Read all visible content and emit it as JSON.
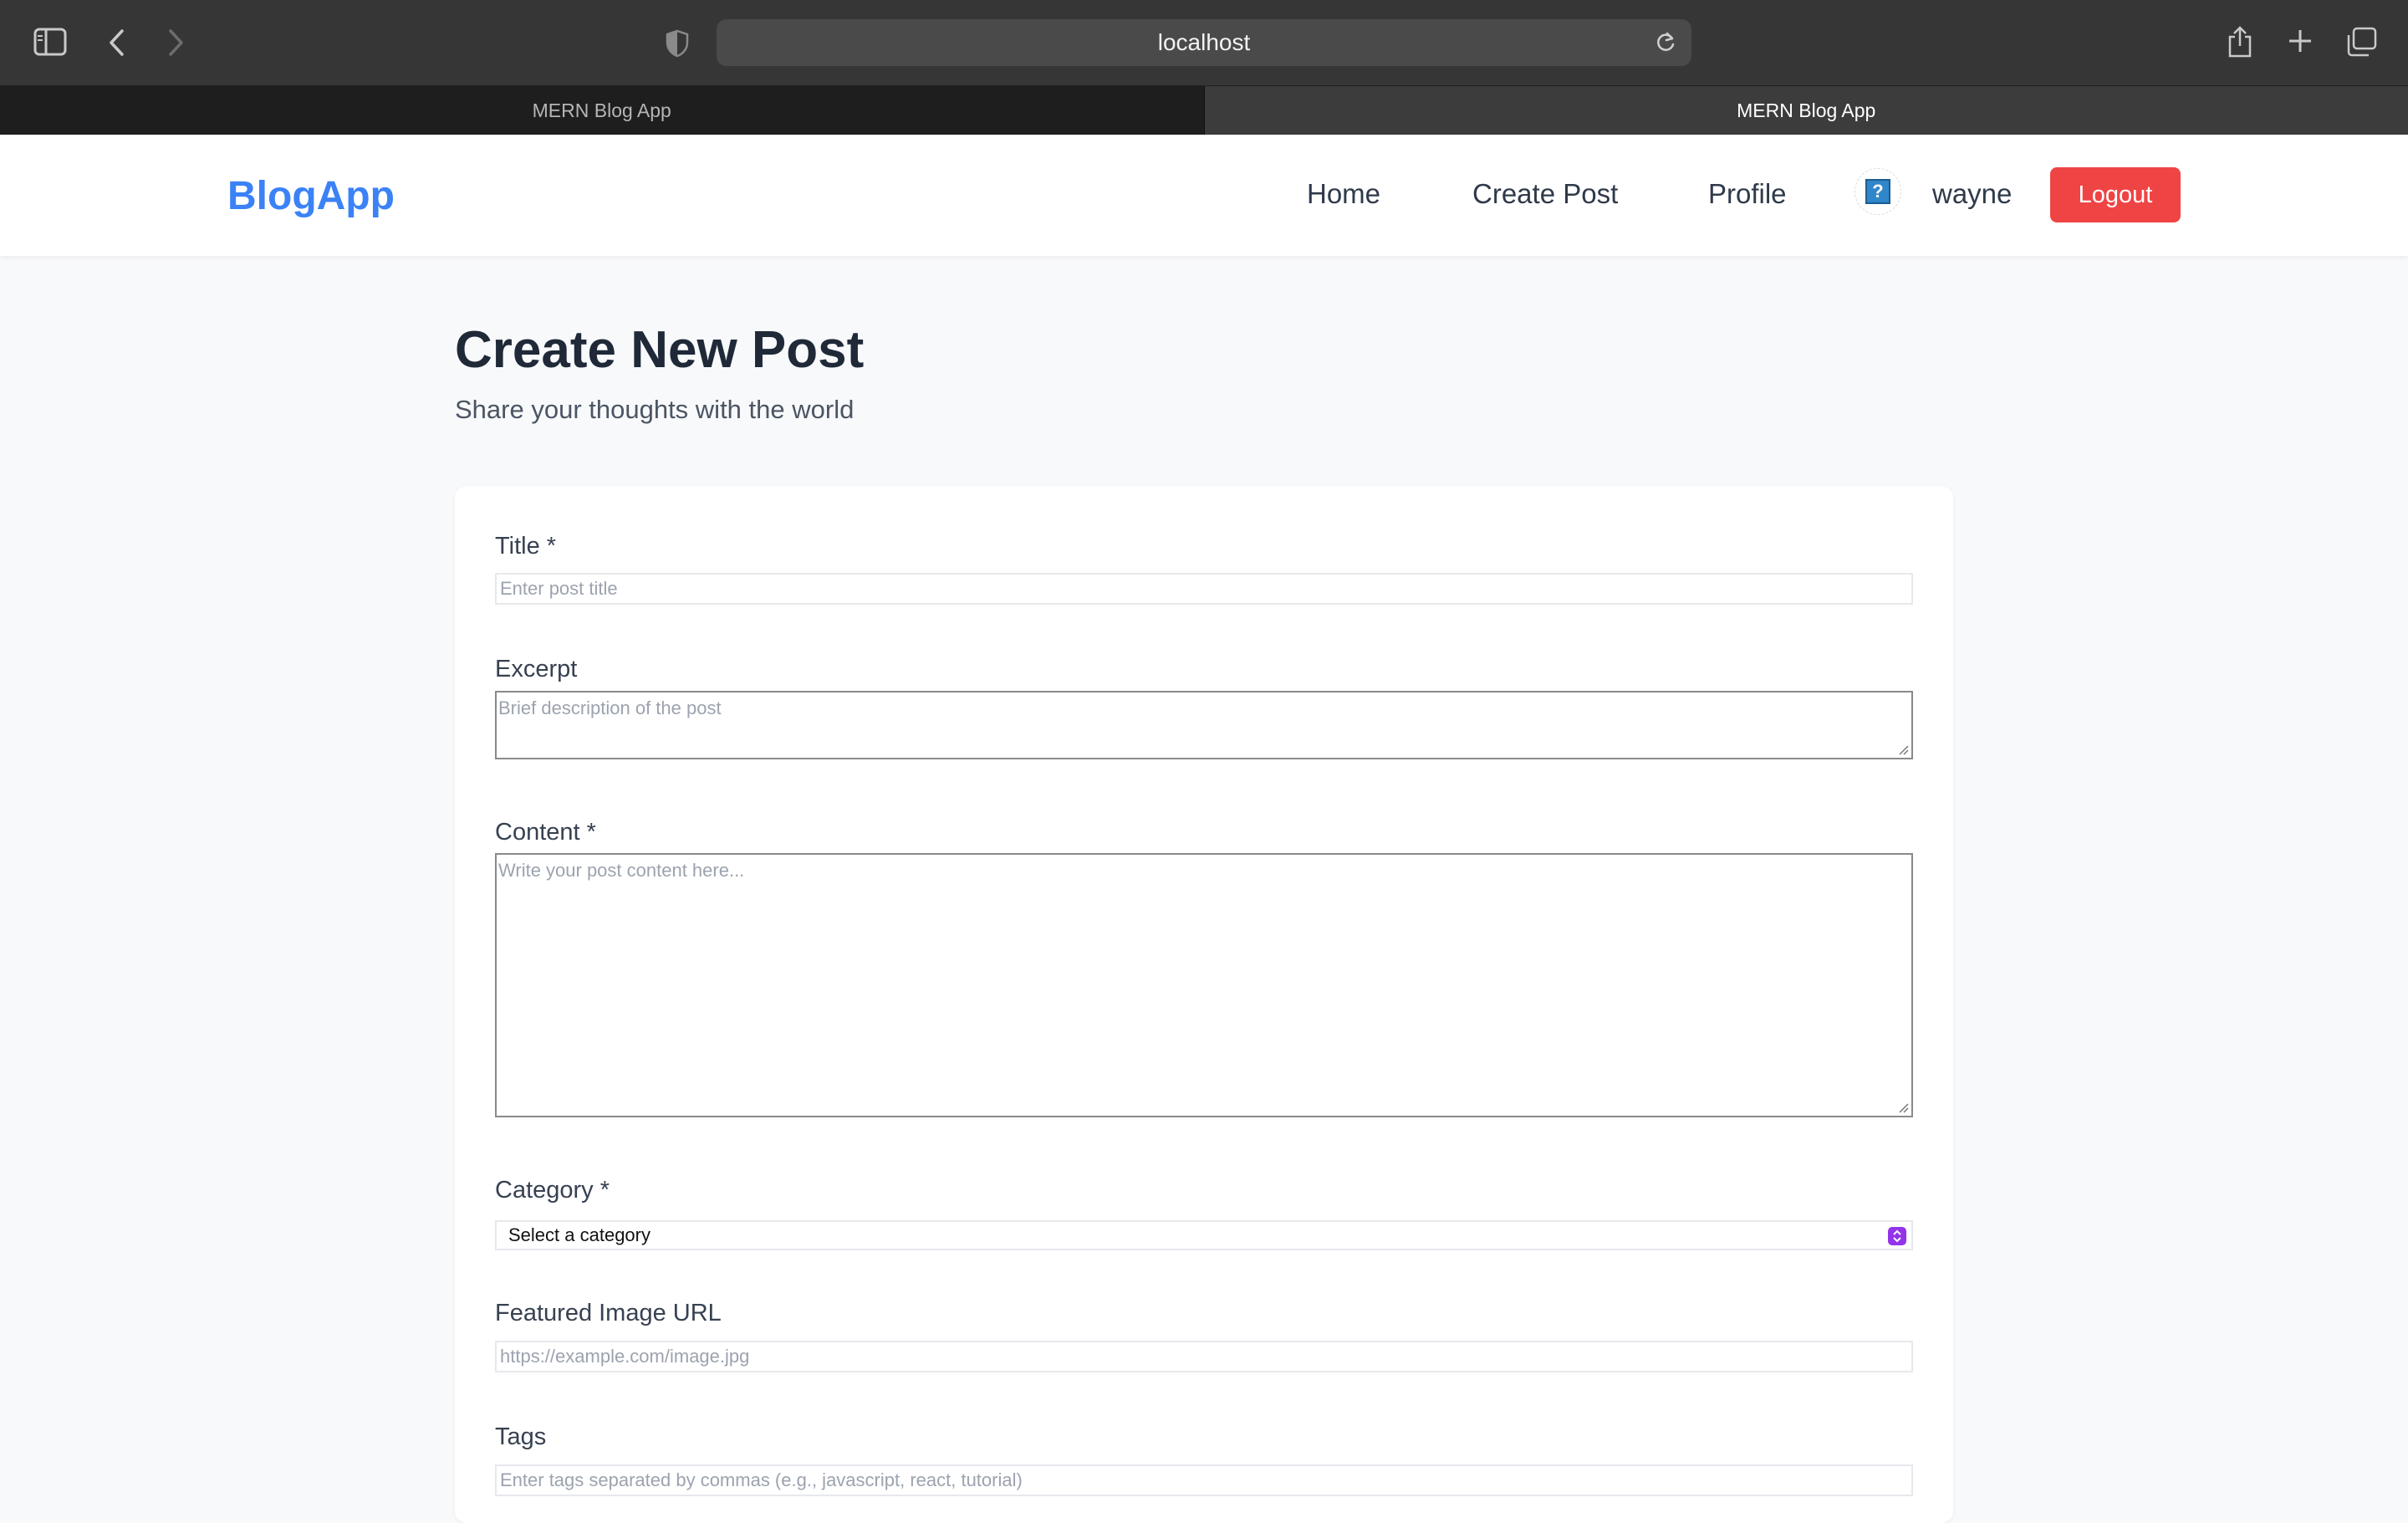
{
  "browser": {
    "url": "localhost",
    "tabs": [
      {
        "title": "MERN Blog App",
        "active": false
      },
      {
        "title": "MERN Blog App",
        "active": true
      }
    ]
  },
  "nav": {
    "brand": "BlogApp",
    "links": [
      "Home",
      "Create Post",
      "Profile"
    ],
    "avatar_glyph": "?",
    "username": "wayne",
    "logout_label": "Logout"
  },
  "page": {
    "title": "Create New Post",
    "subtitle": "Share your thoughts with the world"
  },
  "form": {
    "title": {
      "label": "Title *",
      "placeholder": "Enter post title"
    },
    "excerpt": {
      "label": "Excerpt",
      "placeholder": "Brief description of the post"
    },
    "content": {
      "label": "Content *",
      "placeholder": "Write your post content here..."
    },
    "category": {
      "label": "Category *",
      "selected": "Select a category"
    },
    "image_url": {
      "label": "Featured Image URL",
      "placeholder": "https://example.com/image.jpg"
    },
    "tags": {
      "label": "Tags",
      "placeholder": "Enter tags separated by commas (e.g., javascript, react, tutorial)"
    }
  },
  "colors": {
    "brand": "#3b82f6",
    "logout": "#ef4444",
    "select_accent": "#9333ea"
  }
}
